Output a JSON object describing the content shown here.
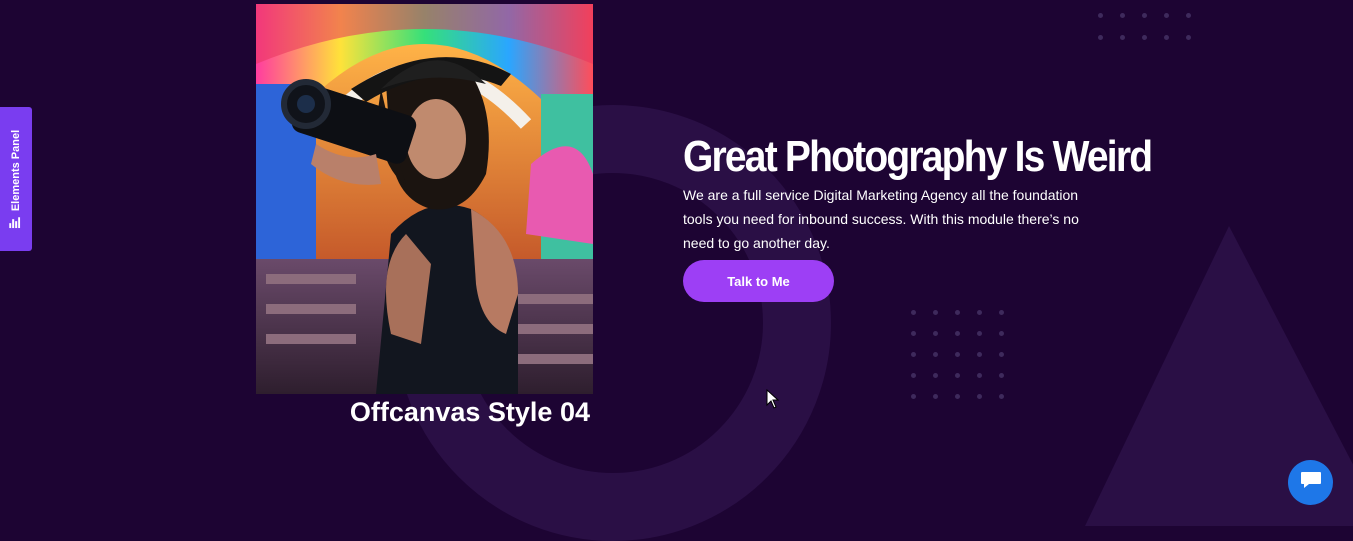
{
  "side_panel": {
    "label": "Elements Panel",
    "icon": "bar-chart-icon"
  },
  "hero": {
    "caption": "Offcanvas Style 04",
    "title": "Great Photography Is Weird",
    "description": "We are a full service Digital Marketing Agency all the foundation tools you need for inbound success. With this module there’s no need to go another day.",
    "cta_label": "Talk to Me",
    "image_alt": "photographer-with-camera-photo"
  },
  "chat": {
    "icon": "chat-bubble-icon"
  },
  "colors": {
    "background": "#1d0433",
    "accent_button": "#9d3ff5",
    "side_tab": "#7a3df0",
    "chat_button": "#1e77e8"
  }
}
